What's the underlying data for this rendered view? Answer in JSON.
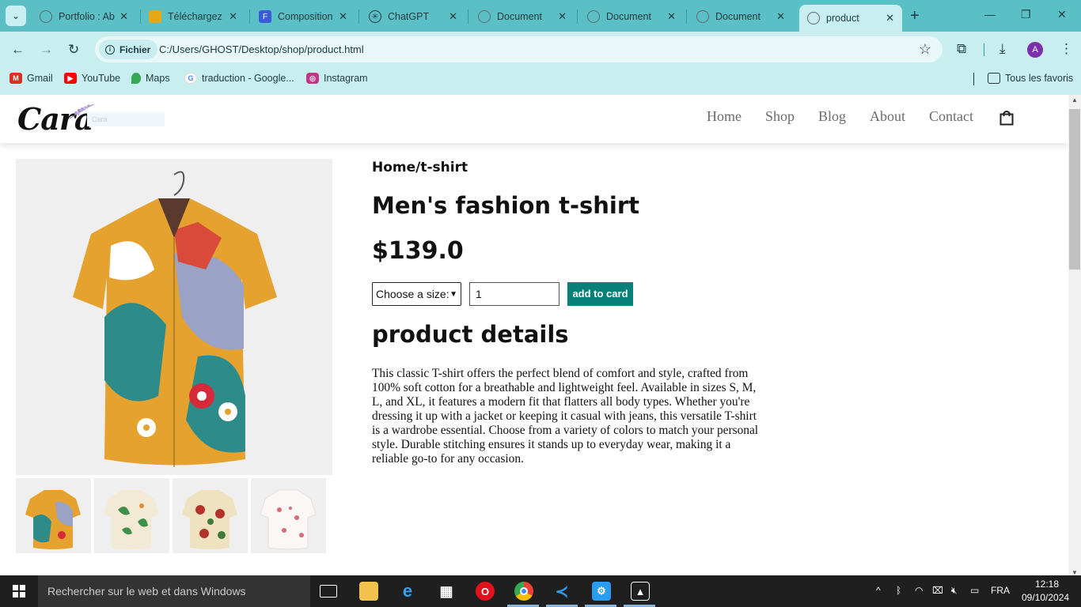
{
  "browser": {
    "tabs": [
      {
        "title": "Portfolio : Ab",
        "favicon_color": "#5f6b6d"
      },
      {
        "title": "Téléchargez",
        "favicon_color": "#e6a817"
      },
      {
        "title": "Composition",
        "favicon_color": "#3b5bdb"
      },
      {
        "title": "ChatGPT",
        "favicon_color": "#1e3a3d"
      },
      {
        "title": "Document",
        "favicon_color": "#5f6b6d"
      },
      {
        "title": "Document",
        "favicon_color": "#5f6b6d"
      },
      {
        "title": "Document",
        "favicon_color": "#5f6b6d"
      },
      {
        "title": "product",
        "favicon_color": "#5f6b6d"
      }
    ],
    "address": {
      "chip": "Fichier",
      "url": "C:/Users/GHOST/Desktop/shop/product.html"
    },
    "profile_initial": "A",
    "bookmarks": [
      {
        "label": "Gmail",
        "icon_color": "#d93025",
        "icon": "M"
      },
      {
        "label": "YouTube",
        "icon_color": "#ff0000",
        "icon": "▶"
      },
      {
        "label": "Maps",
        "icon_color": "#34a853",
        "icon": "⬤"
      },
      {
        "label": "traduction - Google...",
        "icon_color": "#4285f4",
        "icon": "G"
      },
      {
        "label": "Instagram",
        "icon_color": "#c13584",
        "icon": "◎"
      }
    ],
    "all_bookmarks": "Tous les favoris"
  },
  "site": {
    "logo": "Cara",
    "logo_alt": "Cara",
    "nav": [
      "Home",
      "Shop",
      "Blog",
      "About",
      "Contact"
    ]
  },
  "product": {
    "breadcrumb": "Home/t-shirt",
    "title": "Men's fashion t-shirt",
    "price": "$139.0",
    "size_select": "Choose a size:",
    "quantity": "1",
    "add_button": "add to card",
    "details_heading": "product details",
    "details_text": "This classic T-shirt offers the perfect blend of comfort and style, crafted from 100% soft cotton for a breathable and lightweight feel. Available in sizes S, M, L, and XL, it features a modern fit that flatters all body types. Whether you're dressing it up with a jacket or keeping it casual with jeans, this versatile T-shirt is a wardrobe essential. Choose from a variety of colors to match your personal style. Durable stitching ensures it stands up to everyday wear, making it a reliable go-to for any occasion.",
    "accent_color": "#088178"
  },
  "taskbar": {
    "search_placeholder": "Rechercher sur le web et dans Windows",
    "language": "FRA",
    "time": "12:18",
    "date": "09/10/2024"
  }
}
